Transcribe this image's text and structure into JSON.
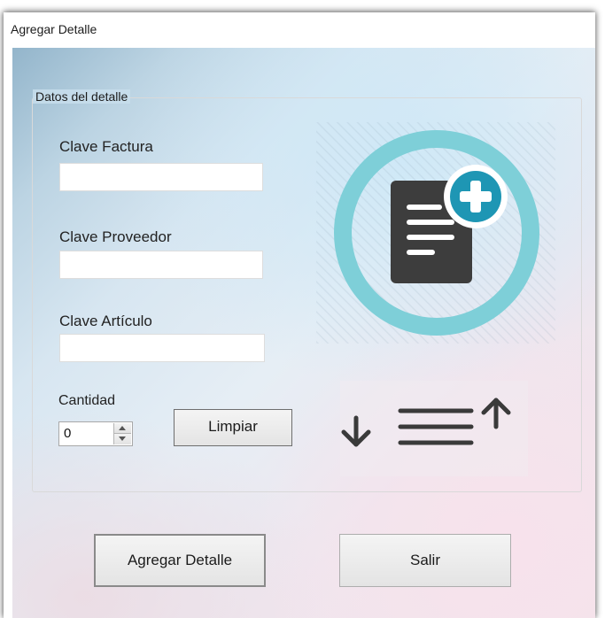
{
  "window": {
    "title": "Agregar Detalle"
  },
  "group": {
    "legend": "Datos del detalle"
  },
  "fields": {
    "clave_factura": {
      "label": "Clave Factura",
      "value": "",
      "placeholder": ""
    },
    "clave_proveedor": {
      "label": "Clave Proveedor",
      "value": "",
      "placeholder": ""
    },
    "clave_articulo": {
      "label": "Clave Artículo",
      "value": "",
      "placeholder": ""
    },
    "cantidad": {
      "label": "Cantidad",
      "value": "0"
    }
  },
  "buttons": {
    "limpiar": "Limpiar",
    "agregar_detalle": "Agregar Detalle",
    "salir": "Salir"
  },
  "icons": {
    "hero": "add-document-icon",
    "sort": "sort-arrows-icon"
  },
  "colors": {
    "accent_teal": "#1e96b4",
    "ring_teal": "#7ecfd8",
    "document_dark": "#3d3d3d"
  }
}
